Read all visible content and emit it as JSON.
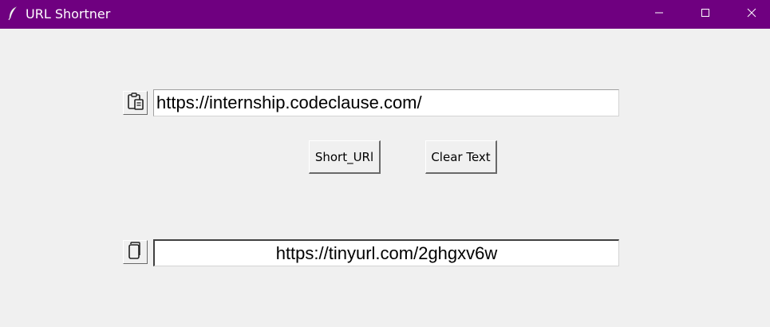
{
  "window": {
    "title": "URL Shortner",
    "titlebar_color": "#6f0080"
  },
  "icons": {
    "app": "feather-icon",
    "paste": "clipboard-paste-icon",
    "copy": "copy-icon",
    "minimize": "minimize-icon",
    "maximize": "maximize-icon",
    "close": "close-icon"
  },
  "input": {
    "value": "https://internship.codeclause.com/"
  },
  "buttons": {
    "short_label": "Short_URl",
    "clear_label": "Clear Text"
  },
  "output": {
    "value": "https://tinyurl.com/2ghgxv6w"
  }
}
